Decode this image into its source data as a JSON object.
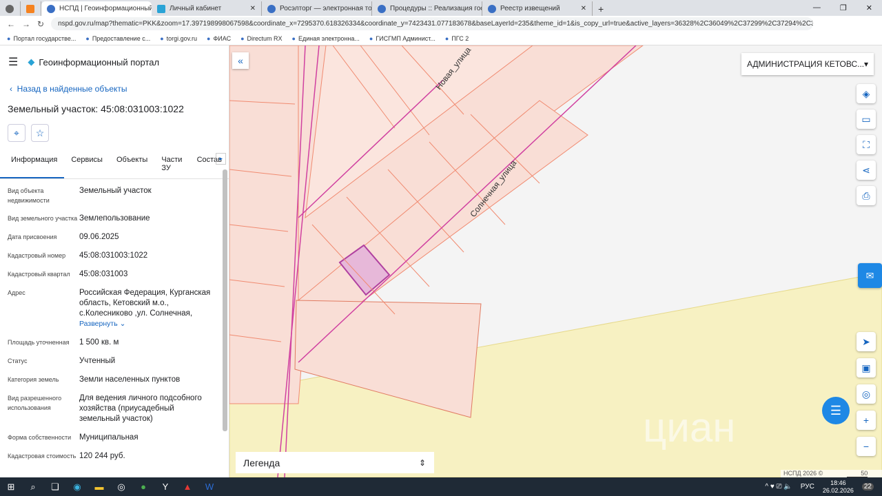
{
  "browser": {
    "tabs": [
      {
        "label": "НСПД | Геоинформационный п",
        "active": true
      },
      {
        "label": "Личный кабинет"
      },
      {
        "label": "Росэлторг — электронная торг"
      },
      {
        "label": "Процедуры :: Реализация госи"
      },
      {
        "label": "Реестр извещений"
      }
    ],
    "url": "nspd.gov.ru/map?thematic=PKK&zoom=17.397198998067598&coordinate_x=7295370.618326334&coordinate_y=7423431.077183678&baseLayerId=235&theme_id=1&is_copy_url=true&active_layers=36328%2C36049%2C37299%2C37294%2C36048&s...",
    "bookmarks": [
      "Портал государстве...",
      "Предоставление с...",
      "torgi.gov.ru",
      "ФИАС",
      "Directum RX",
      "Единая электронна...",
      "ГИСГМП Админист...",
      "ПГС 2"
    ]
  },
  "panel": {
    "portal_title": "Геоинформационный портал",
    "back_label": "Назад в найденные объекты",
    "title": "Земельный участок: 45:08:031003:1022",
    "tabs": [
      "Информация",
      "Сервисы",
      "Объекты",
      "Части ЗУ",
      "Состав"
    ],
    "rows": [
      {
        "k": "Вид объекта недвижимости",
        "v": "Земельный участок"
      },
      {
        "k": "Вид земельного участка",
        "v": "Землепользование"
      },
      {
        "k": "Дата присвоения",
        "v": "09.06.2025"
      },
      {
        "k": "Кадастровый номер",
        "v": "45:08:031003:1022"
      },
      {
        "k": "Кадастровый квартал",
        "v": "45:08:031003"
      },
      {
        "k": "Адрес",
        "v": "Российская Федерация, Курганская область, Кетовский м.о., с.Колесниково ,ул. Солнечная,"
      },
      {
        "k": "Площадь уточненная",
        "v": "1 500 кв. м"
      },
      {
        "k": "Статус",
        "v": "Учтенный"
      },
      {
        "k": "Категория земель",
        "v": "Земли населенных пунктов"
      },
      {
        "k": "Вид разрешенного использования",
        "v": "Для ведения личного подсобного хозяйства (приусадебный земельный участок)"
      },
      {
        "k": "Форма собственности",
        "v": "Муниципальная"
      },
      {
        "k": "Кадастровая стоимость",
        "v": "120 244 руб."
      }
    ],
    "expand_label": "Развернуть"
  },
  "map": {
    "admin_select": "АДМИНИСТРАЦИЯ КЕТОВС...",
    "street1": "Новая_улица",
    "street2": "Солнечная_улица",
    "legend": "Легенда",
    "copyright": "НСПД 2026 ©",
    "scale": "50 m",
    "watermark": "циан"
  },
  "taskbar": {
    "lang": "РУС",
    "time": "18:46",
    "date": "26.02.2026",
    "notif": "22"
  }
}
